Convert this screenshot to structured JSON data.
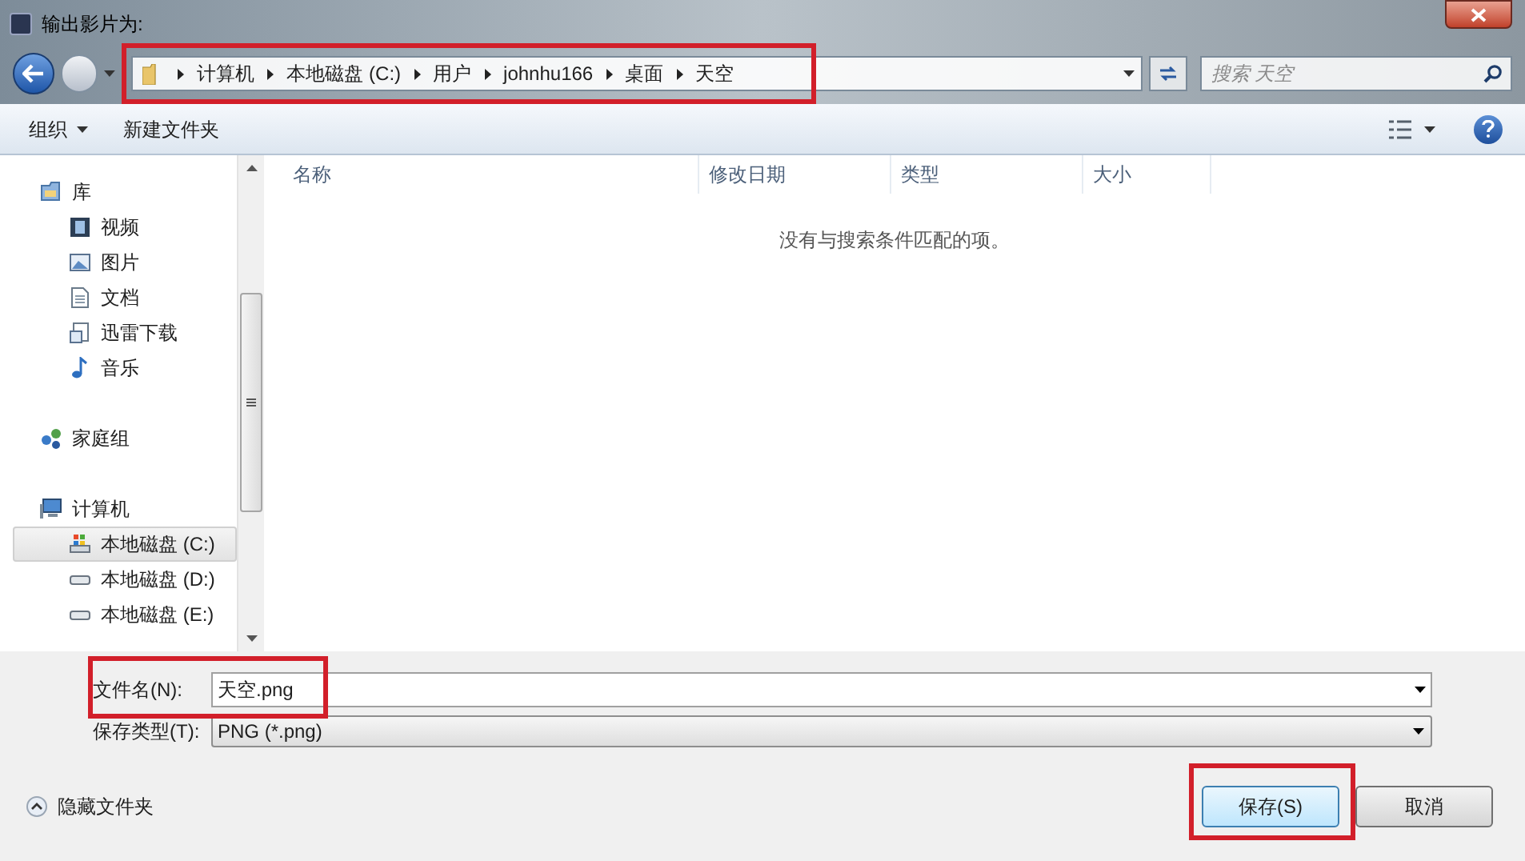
{
  "window": {
    "title": "输出影片为:"
  },
  "address": {
    "highlighted": true,
    "crumbs": [
      "计算机",
      "本地磁盘 (C:)",
      "用户",
      "johnhu166",
      "桌面",
      "天空"
    ]
  },
  "search": {
    "placeholder": "搜索 天空"
  },
  "toolbar": {
    "organize": "组织",
    "new_folder": "新建文件夹"
  },
  "sidebar": {
    "items": [
      {
        "label": "库",
        "kind": "library",
        "selected": false,
        "children": [
          {
            "label": "视频",
            "kind": "video",
            "selected": false
          },
          {
            "label": "图片",
            "kind": "picture",
            "selected": false
          },
          {
            "label": "文档",
            "kind": "document",
            "selected": false
          },
          {
            "label": "迅雷下载",
            "kind": "download",
            "selected": false
          },
          {
            "label": "音乐",
            "kind": "music",
            "selected": false
          }
        ]
      },
      {
        "label": "家庭组",
        "kind": "homegroup",
        "selected": false
      },
      {
        "label": "计算机",
        "kind": "computer",
        "selected": false,
        "children": [
          {
            "label": "本地磁盘 (C:)",
            "kind": "system-drive",
            "selected": true
          },
          {
            "label": "本地磁盘 (D:)",
            "kind": "drive",
            "selected": false
          },
          {
            "label": "本地磁盘 (E:)",
            "kind": "drive",
            "selected": false
          }
        ]
      }
    ]
  },
  "table": {
    "columns": [
      "名称",
      "修改日期",
      "类型",
      "大小"
    ],
    "empty_message": "没有与搜索条件匹配的项。"
  },
  "filename": {
    "label": "文件名(N):",
    "value": "天空.png",
    "highlighted": true
  },
  "filetype": {
    "label": "保存类型(T):",
    "value": "PNG (*.png)"
  },
  "hide_folders": "隐藏文件夹",
  "buttons": [
    {
      "label": "保存(S)",
      "kind": "primary",
      "highlighted": true
    },
    {
      "label": "取消",
      "kind": "normal",
      "highlighted": false
    }
  ]
}
